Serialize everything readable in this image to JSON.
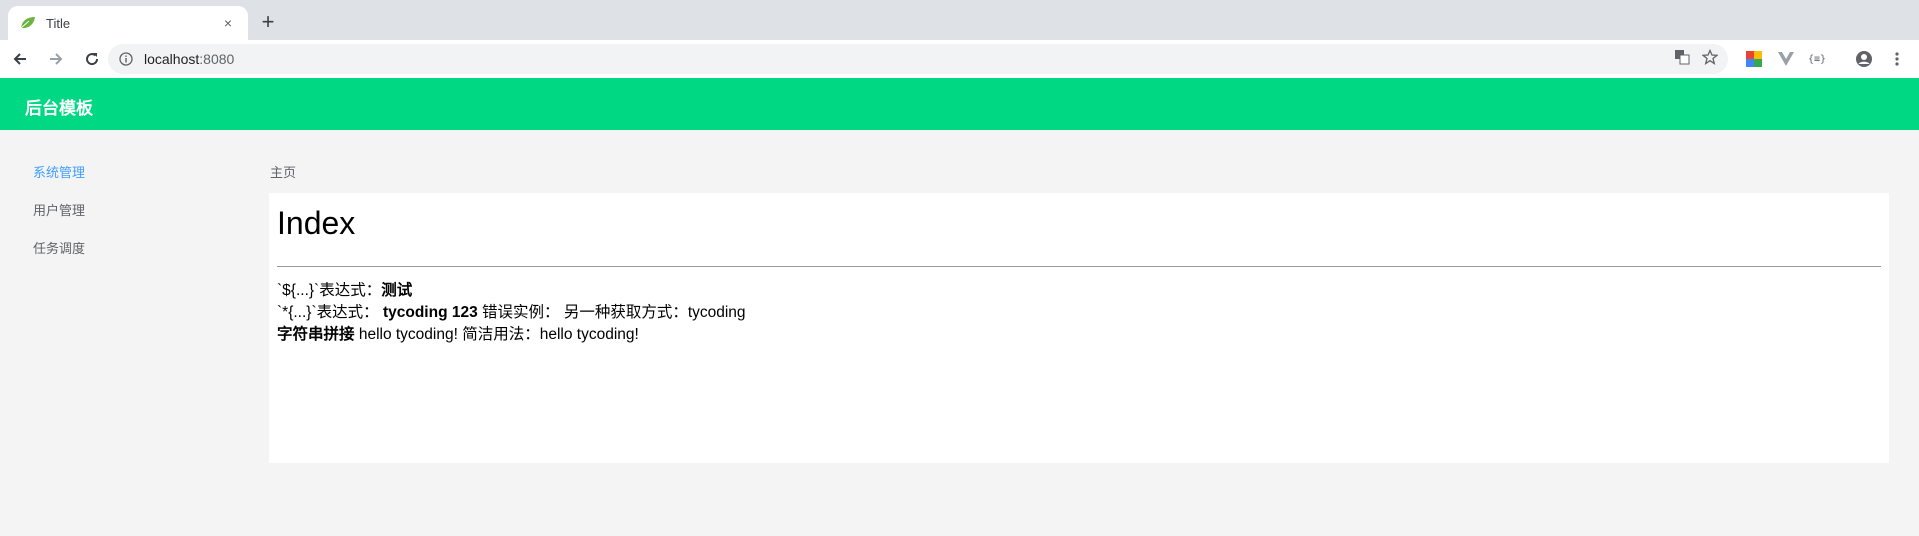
{
  "browser": {
    "tab_title": "Title",
    "tab_close": "×",
    "new_tab": "+",
    "url_host": "localhost",
    "url_port": ":8080"
  },
  "app": {
    "brand": "后台模板"
  },
  "sidebar": {
    "items": [
      {
        "label": "系统管理",
        "active": true
      },
      {
        "label": "用户管理",
        "active": false
      },
      {
        "label": "任务调度",
        "active": false
      }
    ]
  },
  "breadcrumb": "主页",
  "content": {
    "title": "Index",
    "line1_label": "`${...}`表达式：",
    "line1_value": "测试",
    "line2_label": "`*{...}`表达式：",
    "line2_value": "tycoding 123",
    "line2_mid": " 错误实例：  另一种获取方式：tycoding",
    "line3_label": "字符串拼接",
    "line3_rest": " hello tycoding! 简洁用法：hello tycoding!"
  },
  "colors": {
    "header": "#00d883",
    "active_link": "#409eff"
  }
}
